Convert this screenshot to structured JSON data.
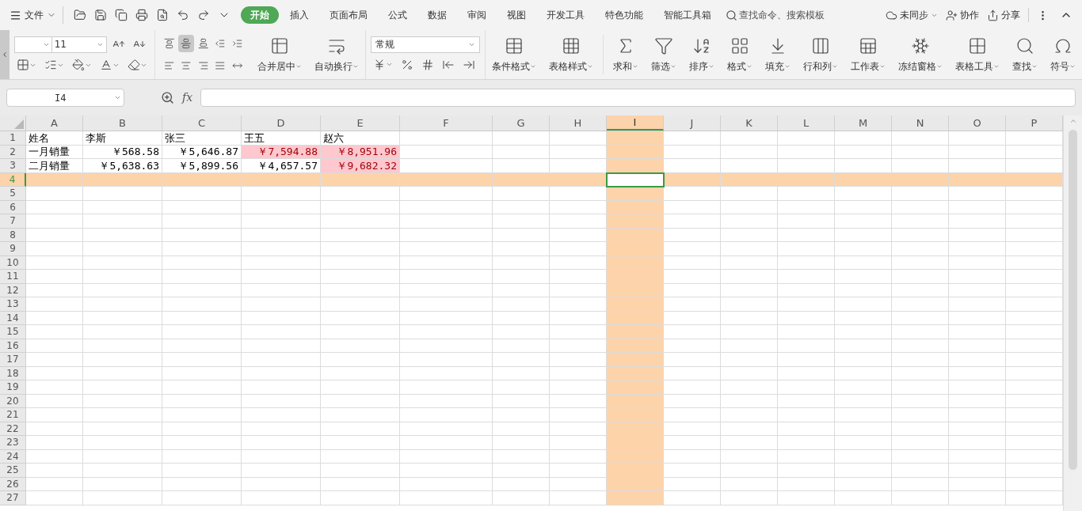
{
  "menu": {
    "label": "文件"
  },
  "tabs": [
    {
      "label": "开始",
      "selected": true
    },
    {
      "label": "插入",
      "selected": false
    },
    {
      "label": "页面布局",
      "selected": false
    },
    {
      "label": "公式",
      "selected": false
    },
    {
      "label": "数据",
      "selected": false
    },
    {
      "label": "审阅",
      "selected": false
    },
    {
      "label": "视图",
      "selected": false
    },
    {
      "label": "开发工具",
      "selected": false
    },
    {
      "label": "特色功能",
      "selected": false
    },
    {
      "label": "智能工具箱",
      "selected": false
    }
  ],
  "search": {
    "placeholder": "查找命令、搜索模板"
  },
  "account": [
    {
      "kind": "sync",
      "label": "未同步"
    },
    {
      "kind": "collab",
      "label": "协作"
    },
    {
      "kind": "share",
      "label": "分享"
    }
  ],
  "ribbon": {
    "font_size": "11",
    "number_format": "常规",
    "alignment": [
      {
        "kind": "top",
        "selected": false
      },
      {
        "kind": "middle",
        "selected": true
      },
      {
        "kind": "bottom",
        "selected": false
      },
      {
        "kind": "outdent",
        "selected": false
      },
      {
        "kind": "indent",
        "selected": false
      },
      {
        "kind": "left",
        "selected": false
      },
      {
        "kind": "center",
        "selected": false
      },
      {
        "kind": "right",
        "selected": false
      },
      {
        "kind": "justify",
        "selected": false
      },
      {
        "kind": "distribute",
        "selected": false
      }
    ],
    "large_buttons": [
      {
        "kind": "merge",
        "label": "合并居中"
      },
      {
        "kind": "wrap",
        "label": "自动换行"
      },
      {
        "kind": "conditional",
        "label": "条件格式"
      },
      {
        "kind": "table_style",
        "label": "表格样式"
      },
      {
        "kind": "sum",
        "label": "求和"
      },
      {
        "kind": "filter",
        "label": "筛选"
      },
      {
        "kind": "sort",
        "label": "排序"
      },
      {
        "kind": "format",
        "label": "格式"
      },
      {
        "kind": "fill",
        "label": "填充"
      },
      {
        "kind": "rowcol",
        "label": "行和列"
      },
      {
        "kind": "sheet",
        "label": "工作表"
      },
      {
        "kind": "freeze",
        "label": "冻结窗格"
      },
      {
        "kind": "table_tools",
        "label": "表格工具"
      },
      {
        "kind": "find",
        "label": "查找"
      },
      {
        "kind": "symbol",
        "label": "符号"
      }
    ]
  },
  "formula_bar": {
    "name_box": "I4",
    "fx": "fx"
  },
  "sheet": {
    "columns": [
      {
        "label": "A",
        "selected": false
      },
      {
        "label": "B",
        "selected": false
      },
      {
        "label": "C",
        "selected": false
      },
      {
        "label": "D",
        "selected": false
      },
      {
        "label": "E",
        "selected": false
      },
      {
        "label": "F",
        "selected": false
      },
      {
        "label": "G",
        "selected": false
      },
      {
        "label": "H",
        "selected": false
      },
      {
        "label": "I",
        "selected": true
      },
      {
        "label": "J",
        "selected": false
      },
      {
        "label": "K",
        "selected": false
      },
      {
        "label": "L",
        "selected": false
      },
      {
        "label": "M",
        "selected": false
      },
      {
        "label": "N",
        "selected": false
      },
      {
        "label": "O",
        "selected": false
      },
      {
        "label": "P",
        "selected": false
      }
    ],
    "rows": [
      {
        "label": "1",
        "selected": false,
        "cells": [
          {
            "text": "姓名",
            "kind": "text",
            "highlighted": false
          },
          {
            "text": "李斯",
            "kind": "text",
            "highlighted": false
          },
          {
            "text": "张三",
            "kind": "text",
            "highlighted": false
          },
          {
            "text": "王五",
            "kind": "text",
            "highlighted": false
          },
          {
            "text": "赵六",
            "kind": "text",
            "highlighted": false
          }
        ]
      },
      {
        "label": "2",
        "selected": false,
        "cells": [
          {
            "text": "一月销量",
            "kind": "text",
            "highlighted": false
          },
          {
            "text": "￥568.58",
            "kind": "number",
            "highlighted": false
          },
          {
            "text": "￥5,646.87",
            "kind": "number",
            "highlighted": false
          },
          {
            "text": "￥7,594.88",
            "kind": "number",
            "highlighted": true
          },
          {
            "text": "￥8,951.96",
            "kind": "number",
            "highlighted": true
          }
        ]
      },
      {
        "label": "3",
        "selected": false,
        "cells": [
          {
            "text": "二月销量",
            "kind": "text",
            "highlighted": false
          },
          {
            "text": "￥5,638.63",
            "kind": "number",
            "highlighted": false
          },
          {
            "text": "￥5,899.56",
            "kind": "number",
            "highlighted": false
          },
          {
            "text": "￥4,657.57",
            "kind": "number",
            "highlighted": false
          },
          {
            "text": "￥9,682.32",
            "kind": "number",
            "highlighted": true
          }
        ]
      },
      {
        "label": "4",
        "selected": true
      },
      {
        "label": "5",
        "selected": false
      },
      {
        "label": "6",
        "selected": false
      },
      {
        "label": "7",
        "selected": false
      },
      {
        "label": "8",
        "selected": false
      },
      {
        "label": "9",
        "selected": false
      },
      {
        "label": "10",
        "selected": false
      },
      {
        "label": "11",
        "selected": false
      },
      {
        "label": "12",
        "selected": false
      },
      {
        "label": "13",
        "selected": false
      },
      {
        "label": "14",
        "selected": false
      },
      {
        "label": "15",
        "selected": false
      },
      {
        "label": "16",
        "selected": false
      },
      {
        "label": "17",
        "selected": false
      },
      {
        "label": "18",
        "selected": false
      },
      {
        "label": "19",
        "selected": false
      },
      {
        "label": "20",
        "selected": false
      },
      {
        "label": "21",
        "selected": false
      },
      {
        "label": "22",
        "selected": false
      },
      {
        "label": "23",
        "selected": false
      },
      {
        "label": "24",
        "selected": false
      },
      {
        "label": "25",
        "selected": false
      },
      {
        "label": "26",
        "selected": false
      },
      {
        "label": "27",
        "selected": false
      }
    ]
  }
}
